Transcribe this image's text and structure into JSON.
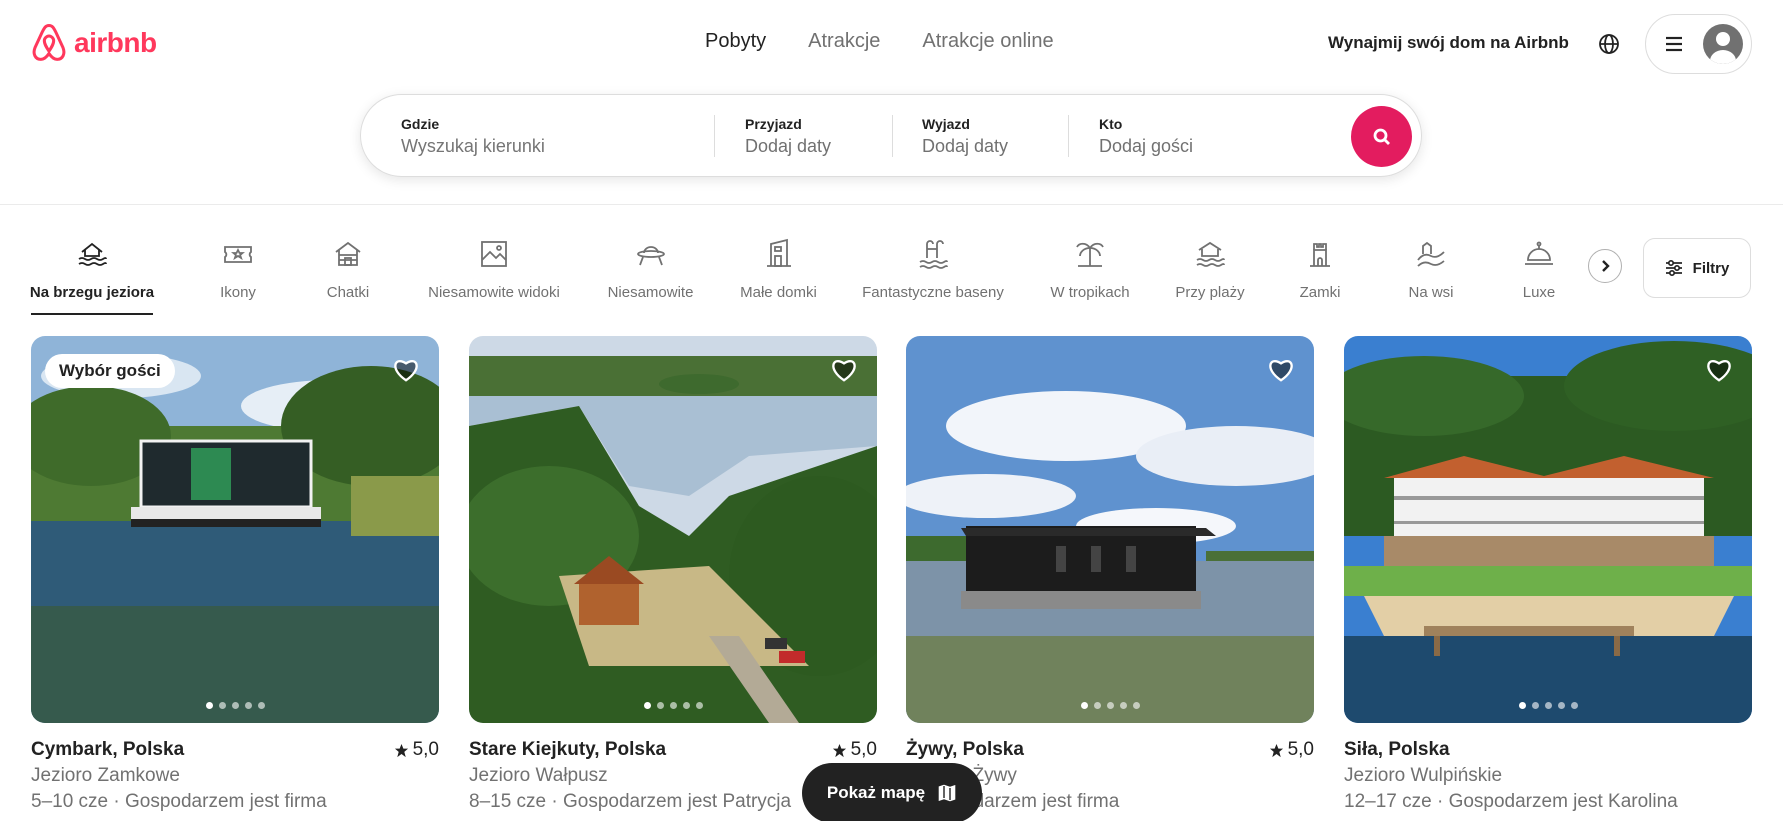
{
  "brand": {
    "name": "airbnb",
    "color": "#ff385c"
  },
  "nav": {
    "tabs": [
      {
        "label": "Pobyty",
        "active": true
      },
      {
        "label": "Atrakcje",
        "active": false
      },
      {
        "label": "Atrakcje online",
        "active": false
      }
    ]
  },
  "header": {
    "host_link": "Wynajmij swój dom na Airbnb",
    "globe_icon": "globe-icon",
    "menu_icon": "hamburger-icon",
    "avatar_icon": "user-avatar-icon"
  },
  "search": {
    "where_label": "Gdzie",
    "where_placeholder": "Wyszukaj kierunki",
    "checkin_label": "Przyjazd",
    "checkin_value": "Dodaj daty",
    "checkout_label": "Wyjazd",
    "checkout_value": "Dodaj daty",
    "who_label": "Kto",
    "who_value": "Dodaj gości",
    "button_icon": "search-icon",
    "button_color": "#e31c5f"
  },
  "categories": [
    {
      "label": "Na brzegu jeziora",
      "icon": "lake-icon",
      "active": true
    },
    {
      "label": "Ikony",
      "icon": "ticket-icon",
      "active": false
    },
    {
      "label": "Chatki",
      "icon": "cabin-icon",
      "active": false
    },
    {
      "label": "Niesamowite widoki",
      "icon": "view-icon",
      "active": false
    },
    {
      "label": "Niesamowite",
      "icon": "ufo-icon",
      "active": false
    },
    {
      "label": "Małe domki",
      "icon": "tiny-home-icon",
      "active": false
    },
    {
      "label": "Fantastyczne baseny",
      "icon": "pool-icon",
      "active": false
    },
    {
      "label": "W tropikach",
      "icon": "tropical-icon",
      "active": false
    },
    {
      "label": "Przy plaży",
      "icon": "beach-icon",
      "active": false
    },
    {
      "label": "Zamki",
      "icon": "castle-icon",
      "active": false
    },
    {
      "label": "Na wsi",
      "icon": "countryside-icon",
      "active": false
    },
    {
      "label": "Luxe",
      "icon": "luxe-icon",
      "active": false
    }
  ],
  "filters": {
    "label": "Filtry",
    "icon": "filters-icon"
  },
  "listings": [
    {
      "location": "Cymbark, Polska",
      "rating": "5,0",
      "line1": "Jezioro Zamkowe",
      "line2": "5–10 cze · Gospodarzem jest firma",
      "badge": "Wybór gości"
    },
    {
      "location": "Stare Kiejkuty, Polska",
      "rating": "5,0",
      "line1": "Jezioro Wałpusz",
      "line2": "8–15 cze · Gospodarzem jest Patrycja",
      "badge": ""
    },
    {
      "location": "Żywy, Polska",
      "rating": "5,0",
      "line1": "Jezioro Żywy",
      "line2": "· Gospodarzem jest firma",
      "badge": ""
    },
    {
      "location": "Siła, Polska",
      "rating": "",
      "line1": "Jezioro Wulpińskie",
      "line2": "12–17 cze · Gospodarzem jest Karolina",
      "badge": ""
    }
  ],
  "map_button": {
    "label": "Pokaż mapę",
    "icon": "map-icon"
  }
}
